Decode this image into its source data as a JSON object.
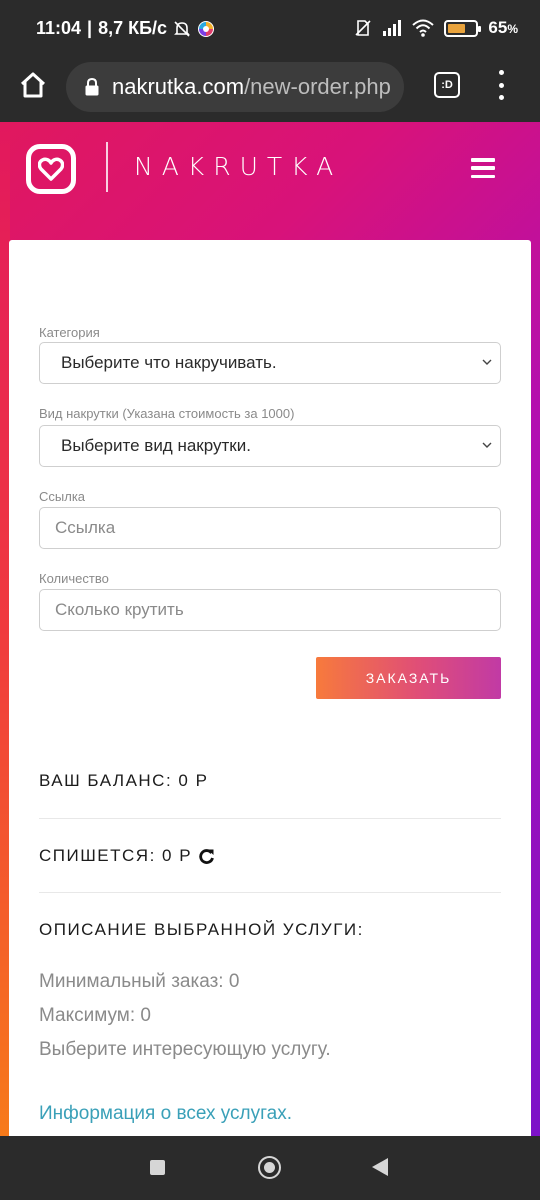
{
  "status_bar": {
    "time": "11:04",
    "separator": "|",
    "speed": "8,7 КБ/с",
    "battery_percent": "65",
    "battery_suffix": "%",
    "battery_level": 0.65
  },
  "browser": {
    "url_host": "nakrutka.com",
    "url_path": "/new-order.php",
    "tabs_label": ":D"
  },
  "header": {
    "brand": "NAKRUTKA"
  },
  "form": {
    "category_label": "Категория",
    "category_value": "Выберите что накручивать.",
    "type_label": "Вид накрутки (Указана стоимость за 1000)",
    "type_value": "Выберите вид накрутки.",
    "link_label": "Ссылка",
    "link_placeholder": "Ссылка",
    "quantity_label": "Количество",
    "quantity_placeholder": "Сколько крутить",
    "order_button": "ЗАКАЗАТЬ"
  },
  "summary": {
    "balance": "ВАШ БАЛАНС: 0 Р",
    "charge": "СПИШЕТСЯ: 0 Р"
  },
  "description": {
    "title": "ОПИСАНИЕ ВЫБРАННОЙ УСЛУГИ:",
    "min_order": "Минимальный заказ: 0",
    "max_order": "Максимум: 0",
    "hint": "Выберите интересующую услугу.",
    "all_services_link": "Информация о всех услугах."
  },
  "colors": {
    "accent_link": "#3aa0b8",
    "gradient_start": "#e0185e",
    "gradient_end": "#7c12c8",
    "button_start": "#f77a3c",
    "button_end": "#c13aa5"
  },
  "icons": [
    "home-icon",
    "lock-icon",
    "tabs-icon",
    "more-vert-icon",
    "heart-logo-icon",
    "hamburger-icon",
    "chevron-down-icon",
    "refresh-icon",
    "mute-icon",
    "nosim-icon",
    "signal-icon",
    "wifi-icon",
    "battery-icon"
  ]
}
